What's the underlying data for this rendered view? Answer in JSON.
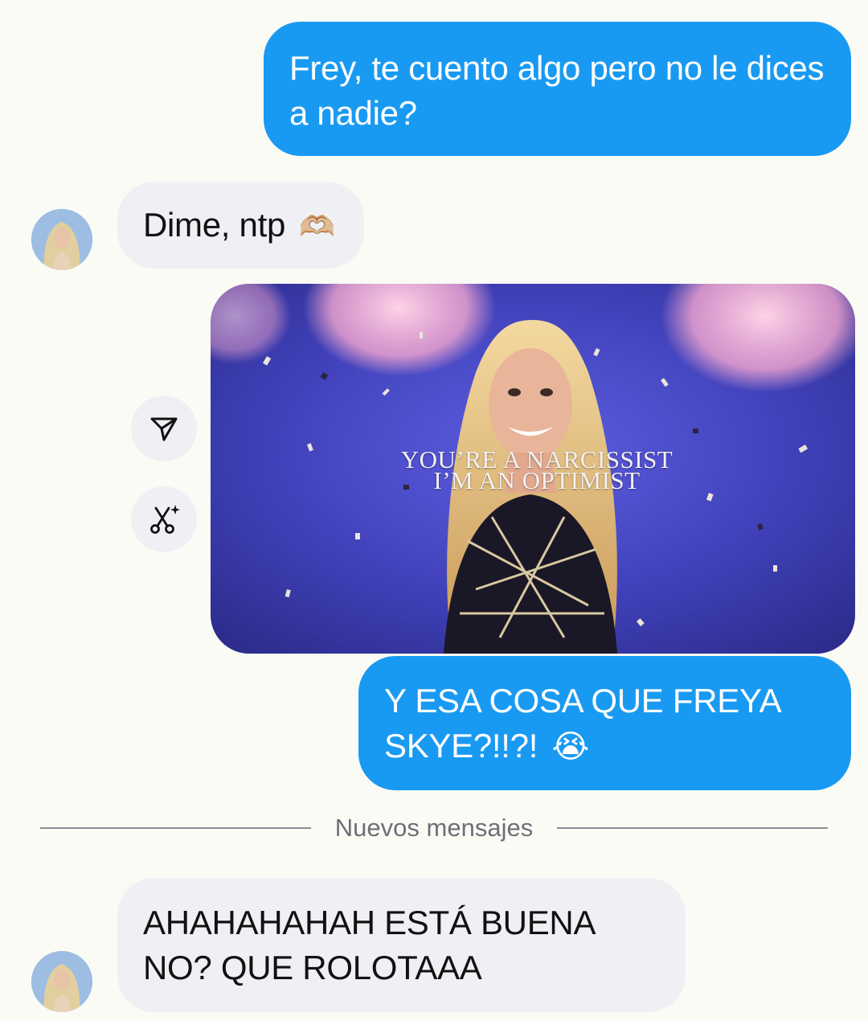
{
  "messages": {
    "m1": {
      "text": "Frey, te cuento algo pero no le dices a nadie?"
    },
    "m2": {
      "text": "Dime, ntp",
      "emoji": "🫶🏼"
    },
    "m3": {
      "caption_line1": "YOU’RE A NARCISSIST",
      "caption_line2": "I’M AN OPTIMIST"
    },
    "m4": {
      "text": "Y ESA COSA QUE FREYA SKYE?!!?!",
      "emoji": "😭"
    },
    "m5": {
      "text": "AHAHAHAHAH ESTÁ BUENA NO? QUE ROLOTAAA"
    }
  },
  "divider": {
    "label": "Nuevos mensajes"
  },
  "actions": {
    "share_icon": "send-icon",
    "remix_icon": "scissors-sparkle-icon"
  },
  "colors": {
    "sent_bubble": "#199af2",
    "received_bubble": "#eef0f3",
    "background": "#fbfbf6"
  }
}
